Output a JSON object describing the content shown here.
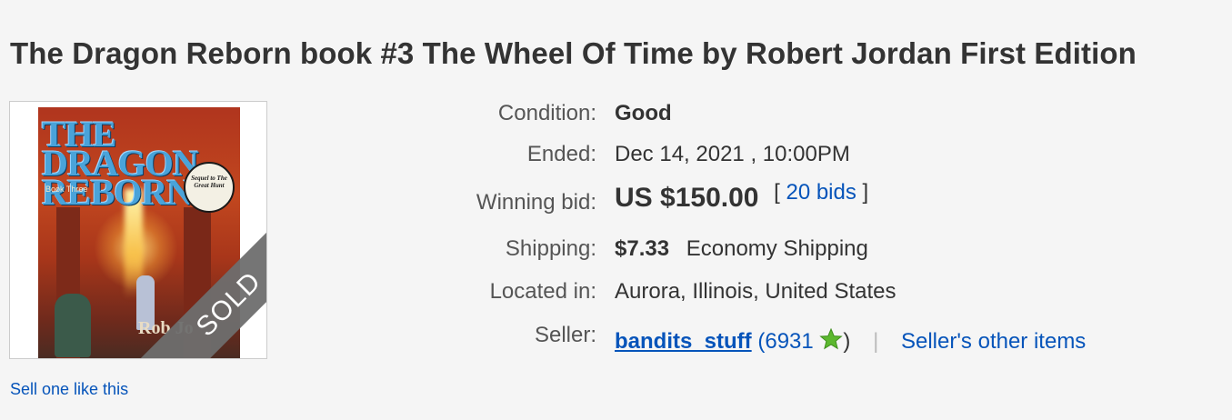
{
  "title": "The Dragon Reborn book #3 The Wheel Of Time by Robert Jordan First Edition",
  "image": {
    "cover_title_line1": "THE DRAGON",
    "cover_title_line2": "REBORN",
    "cover_book_num": "Book Three",
    "cover_badge": "Sequel to The Great Hunt",
    "cover_author": "Rob Jo",
    "sold_label": "SOLD"
  },
  "sell_link": "Sell one like this",
  "details": {
    "condition_label": "Condition:",
    "condition_value": "Good",
    "ended_label": "Ended:",
    "ended_value": "Dec 14, 2021 , 10:00PM",
    "winning_label": "Winning bid:",
    "winning_value": "US $150.00",
    "bids_open": "[",
    "bids_link": "20 bids",
    "bids_close": "]",
    "shipping_label": "Shipping:",
    "shipping_cost": "$7.33",
    "shipping_service": "Economy Shipping",
    "location_label": "Located in:",
    "location_value": "Aurora, Illinois, United States",
    "seller_label": "Seller:",
    "seller_name": "bandits_stuff",
    "feedback_open": "(",
    "feedback_score": "6931",
    "feedback_close": ")",
    "separator": "|",
    "other_items_link": "Seller's other items"
  },
  "colors": {
    "link": "#0654ba",
    "star": "#5cb82e",
    "ribbon": "#6e6e6e"
  },
  "icons": {
    "feedback_star": "green-star-icon"
  }
}
